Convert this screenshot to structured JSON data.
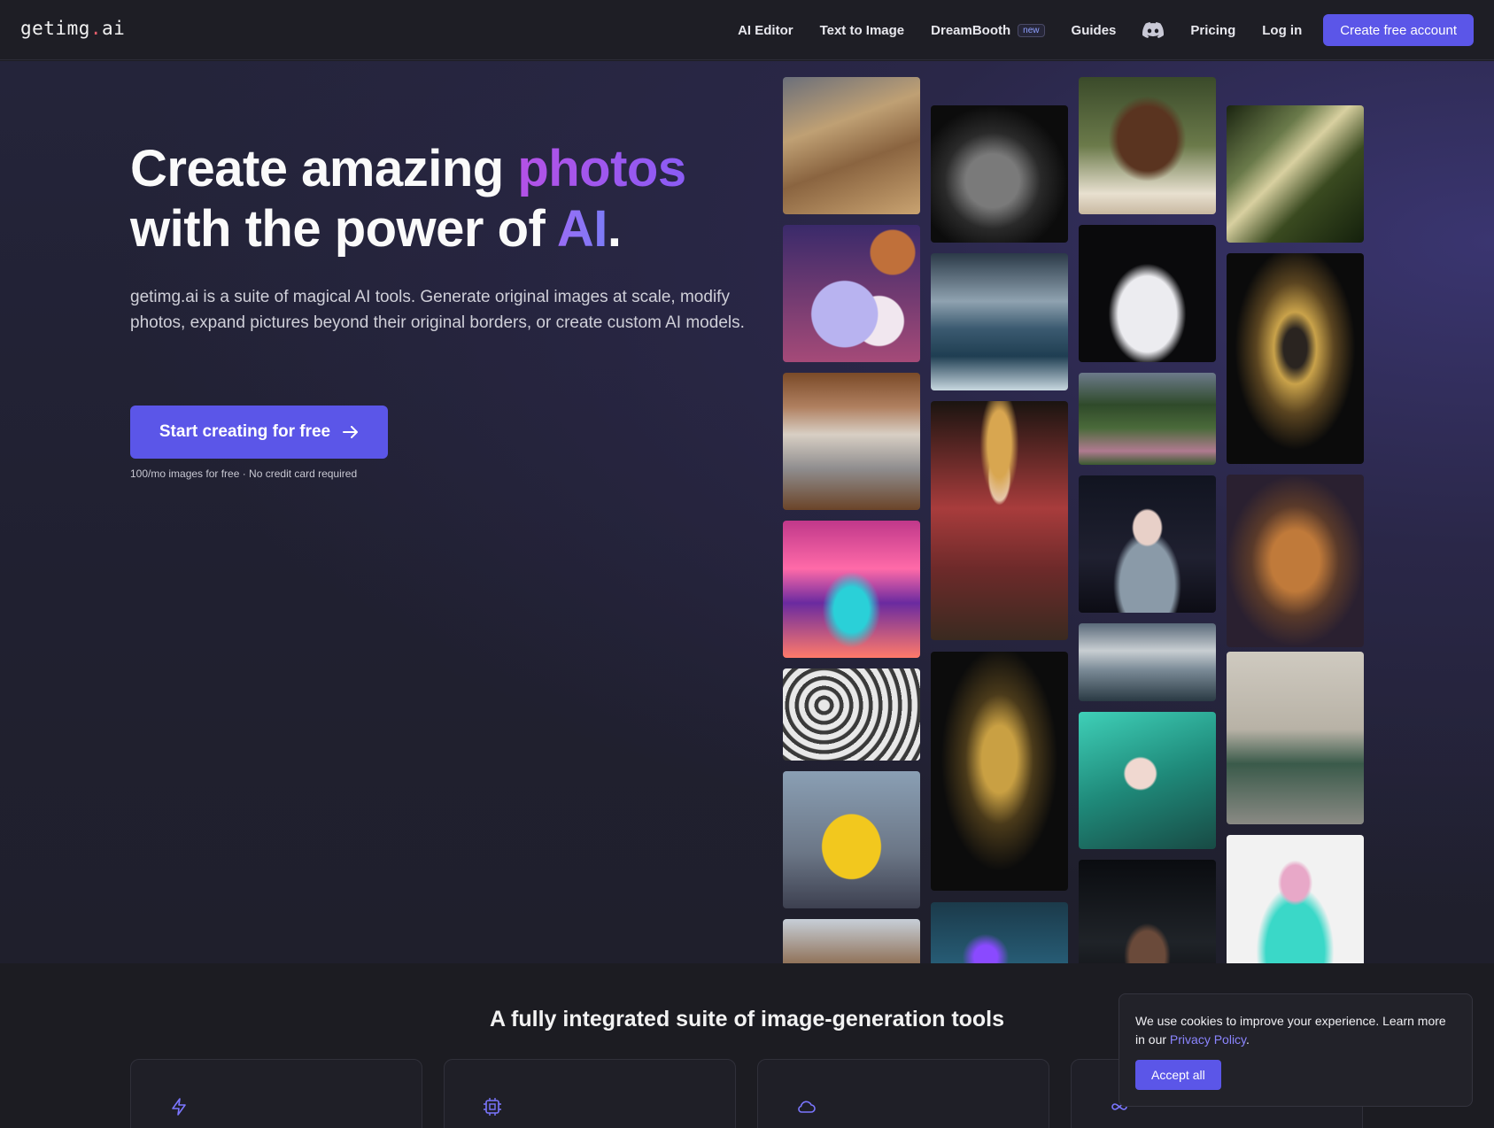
{
  "nav": {
    "logo_main": "getimg",
    "logo_dot": ".",
    "logo_suffix": "ai",
    "links": [
      "AI Editor",
      "Text to Image",
      "DreamBooth",
      "Guides",
      "Pricing",
      "Log in"
    ],
    "dreambooth_badge": "new",
    "discord_icon": "discord-icon",
    "cta": "Create free account"
  },
  "hero": {
    "title_part1": "Create amazing ",
    "title_highlight1": "photos",
    "title_part2": "with the power of ",
    "title_highlight2": "AI",
    "title_end": ".",
    "description": "getimg.ai is a suite of magical AI tools. Generate original images at scale, modify photos, expand pictures beyond their original borders, or create custom AI models.",
    "button_label": "Start creating for free",
    "button_icon": "arrow-right-icon",
    "note": "100/mo images for free · No credit card required"
  },
  "gallery": {
    "images": [
      "pyramid",
      "man-portrait-bw",
      "smiling-man",
      "sunlit-forest",
      "bunny-and-cat",
      "stormy-sea",
      "white-sneaker",
      "golden-mask",
      "bedroom",
      "garden",
      "geisha",
      "anime-girl-armor",
      "armored-warrior",
      "neon-car",
      "clouds",
      "white-pattern",
      "golden-plant",
      "green-hair-anime",
      "classic-cars-hall",
      "pikachu",
      "robot-face",
      "pink-hair-girl",
      "mountain-car",
      "cyber-face"
    ]
  },
  "features": {
    "title": "A fully integrated suite of image-generation tools",
    "card_icons": [
      "bolt-icon",
      "chip-icon",
      "cloud-icon",
      "infinity-icon"
    ]
  },
  "cookie": {
    "text": "We use cookies to improve your experience. Learn more in our ",
    "link": "Privacy Policy",
    "end": ".",
    "button": "Accept all"
  },
  "colors": {
    "accent": "#5b56e8",
    "background": "#1d1d24",
    "highlight_purple": "#b452e6"
  }
}
